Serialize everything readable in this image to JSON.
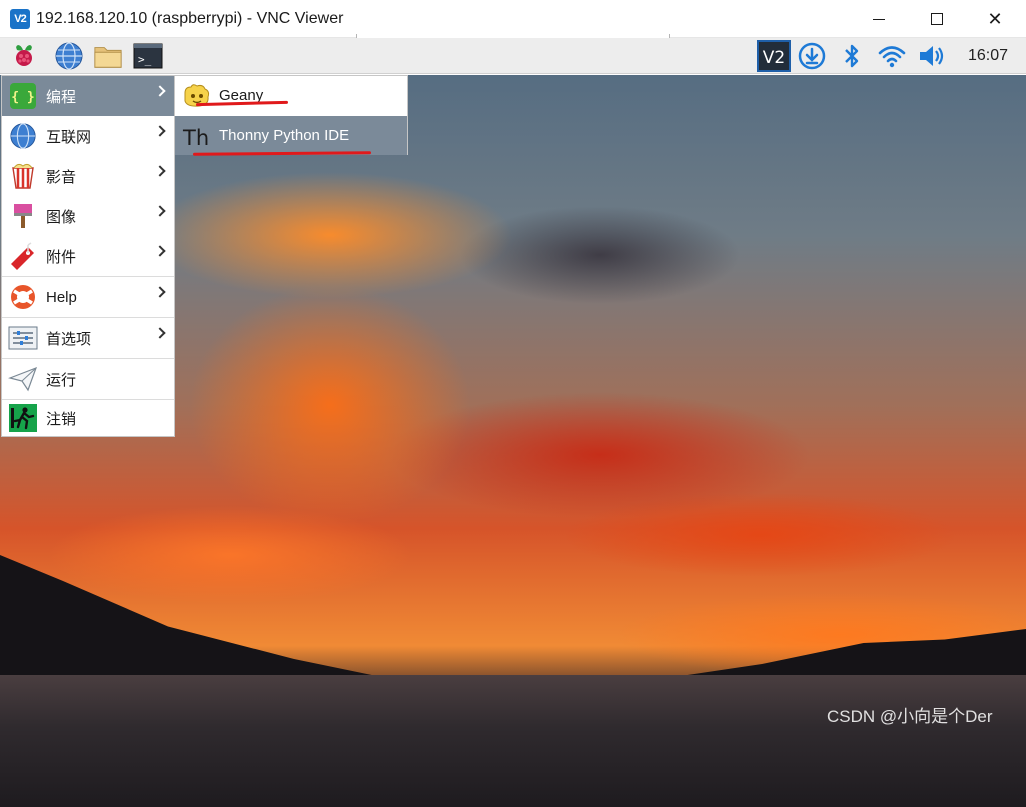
{
  "window": {
    "logo": "V2",
    "title": "192.168.120.10 (raspberrypi) - VNC Viewer",
    "close_glyph": "✕"
  },
  "taskbar": {
    "icons": [
      "raspberry-icon",
      "web-browser-icon",
      "file-manager-icon",
      "terminal-icon"
    ],
    "tray_icons": [
      "vnc-server-icon",
      "download-icon",
      "bluetooth-icon",
      "wifi-icon",
      "volume-icon"
    ],
    "vnc_label": "V2",
    "terminal_label": ">_",
    "clock": "16:07"
  },
  "menu": {
    "items": [
      {
        "label": "编程",
        "icon": "programming-icon",
        "has_submenu": true,
        "active": true
      },
      {
        "label": "互联网",
        "icon": "internet-icon",
        "has_submenu": true
      },
      {
        "label": "影音",
        "icon": "sound-video-icon",
        "has_submenu": true
      },
      {
        "label": "图像",
        "icon": "graphics-icon",
        "has_submenu": true
      },
      {
        "label": "附件",
        "icon": "accessories-icon",
        "has_submenu": true
      },
      {
        "label": "Help",
        "icon": "help-icon",
        "has_submenu": true
      },
      {
        "label": "首选项",
        "icon": "preferences-icon",
        "has_submenu": true
      },
      {
        "label": "运行",
        "icon": "run-icon",
        "has_submenu": false
      },
      {
        "label": "注销",
        "icon": "logout-icon",
        "has_submenu": false
      }
    ],
    "programming_icon_glyph": "{ }"
  },
  "submenu": {
    "items": [
      {
        "label": "Geany",
        "icon": "geany-icon",
        "active": false
      },
      {
        "label": "Thonny Python IDE",
        "icon": "thonny-icon",
        "active": true
      }
    ],
    "thonny_glyph": "Th"
  },
  "watermark": "CSDN @小向是个Der",
  "colors": {
    "menu_highlight": "#7b8a99",
    "annotation_red": "#e0191b",
    "vnc_blue": "#1a73c8"
  }
}
